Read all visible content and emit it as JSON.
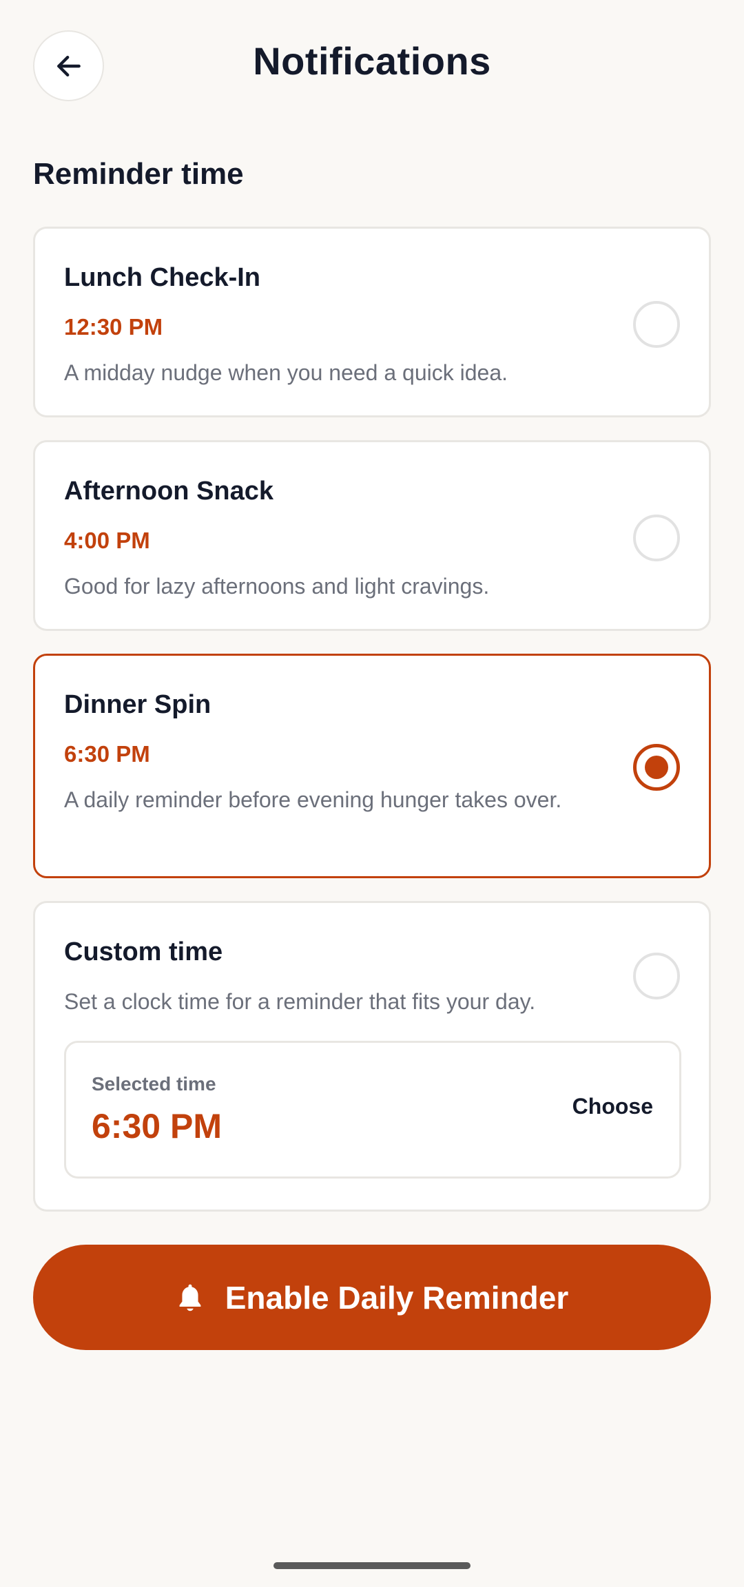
{
  "header": {
    "title": "Notifications",
    "back_icon": "arrow-left-icon"
  },
  "section": {
    "title": "Reminder time"
  },
  "options": [
    {
      "title": "Lunch Check-In",
      "time": "12:30 PM",
      "description": "A midday nudge when you need a quick idea.",
      "selected": false
    },
    {
      "title": "Afternoon Snack",
      "time": "4:00 PM",
      "description": "Good for lazy afternoons and light cravings.",
      "selected": false
    },
    {
      "title": "Dinner Spin",
      "time": "6:30 PM",
      "description": "A daily reminder before evening hunger takes over.",
      "selected": true
    }
  ],
  "custom": {
    "title": "Custom time",
    "description": "Set a clock time for a reminder that fits your day.",
    "selected": false,
    "selected_label": "Selected time",
    "selected_value": "6:30 PM",
    "choose_label": "Choose"
  },
  "cta": {
    "label": "Enable Daily Reminder",
    "icon": "bell-icon"
  },
  "colors": {
    "accent": "#c2410c",
    "background": "#faf8f5",
    "text": "#141a2b",
    "muted": "#6b6f7a"
  }
}
